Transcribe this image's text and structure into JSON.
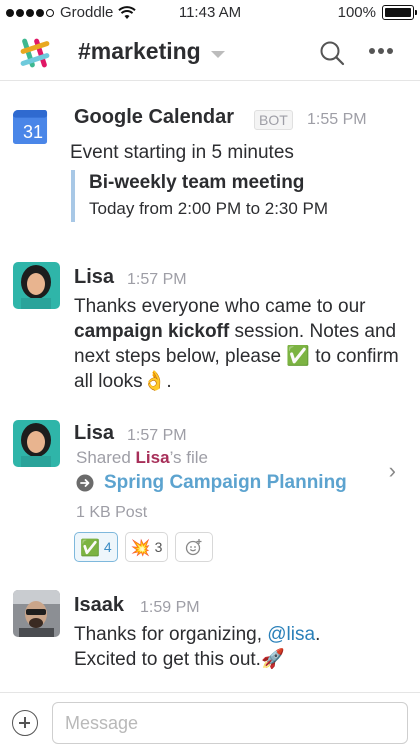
{
  "status_bar": {
    "carrier": "Groddle",
    "time": "11:43 AM",
    "battery": "100%"
  },
  "header": {
    "channel": "#marketing"
  },
  "messages": [
    {
      "author": "Google Calendar",
      "badge": "BOT",
      "time": "1:55 PM",
      "avatar_text": "31",
      "text": "Event starting in 5 minutes",
      "attachment": {
        "title": "Bi-weekly team meeting",
        "subtitle": "Today from 2:00 PM to 2:30 PM"
      }
    },
    {
      "author": "Lisa",
      "time": "1:57 PM",
      "text_1": "Thanks everyone who came to our ",
      "text_bold": "campaign kickoff",
      "text_2": " session. Notes and next steps below, please ",
      "emoji_check": "✅",
      "text_3": " to confirm all looks",
      "emoji_ok": "👌",
      "text_4": "."
    },
    {
      "author": "Lisa",
      "time": "1:57 PM",
      "shared_prefix": "Shared ",
      "shared_owner": "Lisa",
      "shared_suffix": "’s file",
      "file_name": "Spring Campaign Planning",
      "file_meta": "1 KB Post",
      "reactions": [
        {
          "emoji": "✅",
          "count": "4"
        },
        {
          "emoji": "💥",
          "count": "3"
        }
      ]
    },
    {
      "author": "Isaak",
      "time": "1:59 PM",
      "text_1": "Thanks for organizing, ",
      "mention": "@lisa",
      "text_2": ".",
      "text_3": "Excited to get this out.",
      "emoji_rocket": "🚀"
    }
  ],
  "composer": {
    "placeholder": "Message"
  },
  "colors": {
    "accent_link": "#5ca3cf",
    "mention": "#2a80b9",
    "owner_name": "#a72f59",
    "attachment_bar": "#a8c8e6"
  }
}
